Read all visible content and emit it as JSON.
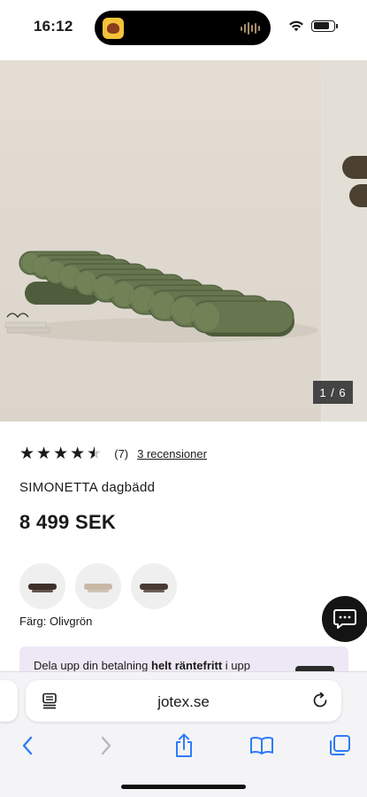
{
  "status_bar": {
    "time": "16:12"
  },
  "gallery": {
    "counter": "1 / 6"
  },
  "product": {
    "rating": 4.5,
    "rating_count": "(7)",
    "reviews_link": "3 recensioner",
    "name": "SIMONETTA dagbädd",
    "price": "8 499 SEK"
  },
  "colors": {
    "swatches": [
      {
        "name": "swatch-dark-brown",
        "color": "#3d3029"
      },
      {
        "name": "swatch-beige",
        "color": "#c8b9a6"
      },
      {
        "name": "swatch-dark-brown-2",
        "color": "#4a3b34"
      }
    ],
    "label": "Färg: Olivgrön"
  },
  "payment_banner": {
    "text_before": "Dela upp din betalning ",
    "text_bold": "helt räntefritt",
    "text_after": " i upp"
  },
  "browser": {
    "address": "jotex.se"
  },
  "theme": {
    "sofa_green": "#5f6e4a",
    "link_blue": "#2f7cf6"
  }
}
